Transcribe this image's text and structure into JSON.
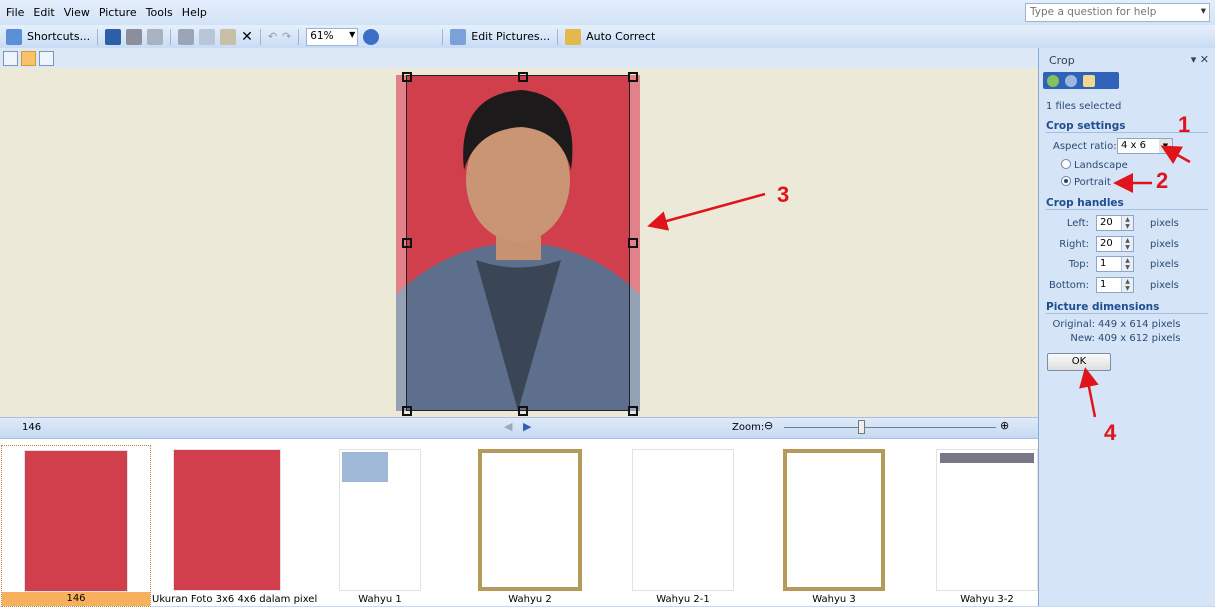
{
  "menu": [
    "File",
    "Edit",
    "View",
    "Picture",
    "Tools",
    "Help"
  ],
  "help_placeholder": "Type a question for help",
  "toolbar": {
    "shortcuts": "Shortcuts...",
    "zoom": "61%",
    "edit_pictures": "Edit Pictures...",
    "auto_correct": "Auto Correct"
  },
  "status": {
    "filename": "146",
    "zoom_label": "Zoom:",
    "zoom_level": 0.62
  },
  "filmstrip": [
    "146",
    "Ukuran Foto 3x6 4x6 dalam pixel",
    "Wahyu 1",
    "Wahyu 2",
    "Wahyu 2-1",
    "Wahyu 3",
    "Wahyu 3-2"
  ],
  "panel": {
    "title": "Crop",
    "files_selected": "1 files selected",
    "crop_settings": "Crop settings",
    "aspect_label": "Aspect ratio:",
    "aspect_value": "4 x 6",
    "landscape": "Landscape",
    "portrait": "Portrait",
    "orientation": "Portrait",
    "crop_handles": "Crop handles",
    "handles": [
      {
        "label": "Left:",
        "value": "20"
      },
      {
        "label": "Right:",
        "value": "20"
      },
      {
        "label": "Top:",
        "value": "1"
      },
      {
        "label": "Bottom:",
        "value": "1"
      }
    ],
    "unit": "pixels",
    "dimensions": "Picture dimensions",
    "original_label": "Original:",
    "original": "449 x 614 pixels",
    "new_label": "New:",
    "new": "409 x 612 pixels",
    "ok": "OK"
  },
  "annotations": [
    "1",
    "2",
    "3",
    "4"
  ],
  "colors": {
    "annotation": "#e0141b",
    "photo_bg": "#d13e4c",
    "selection": "#f7b15c"
  }
}
